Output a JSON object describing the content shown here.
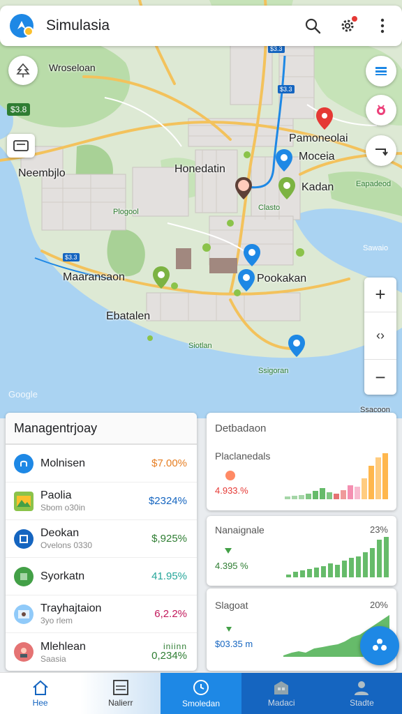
{
  "app": {
    "title": "Simulasia"
  },
  "map": {
    "labels": {
      "wroseloan": "Wroseloan",
      "nembjlo": "Neembjlo",
      "honedatin": "Honedatin",
      "pamoneolai": "Pamoneolai",
      "mocela": "Moceia",
      "kadan": "Kadan",
      "masanasaon": "Maaransaon",
      "pookakan": "Pookakan",
      "ebatalen": "Ebatalen"
    },
    "small_labels": {
      "plogool": "Plogool",
      "clasto": "Clasto",
      "siotlan": "Siotlan",
      "eapadeod": "Eapadeod",
      "ssigoran": "Ssigoran",
      "sawaio": "Sawaio",
      "ssacoon": "Ssacoon"
    },
    "badges": {
      "left_green": "$3.8",
      "top1": "$3.3",
      "top2": "$3.3",
      "blue_left": "$3.3"
    },
    "attribution": "Google"
  },
  "management": {
    "title": "Managentrjoay",
    "rows": [
      {
        "name": "Molnisen",
        "sub": "",
        "value": "$7.00%",
        "color": "#e67e22",
        "icon": "blue-circle-icon"
      },
      {
        "name": "Paolia",
        "sub": "Sbom o30in",
        "value": "$2324%",
        "color": "#1565c0",
        "icon": "landscape-icon"
      },
      {
        "name": "Deokan",
        "sub": "Ovelons 0330",
        "value": "$,925%",
        "color": "#2e7d32",
        "icon": "blue-square-icon"
      },
      {
        "name": "Syorkatn",
        "sub": "",
        "value": "41.95%",
        "color": "#26a69a",
        "icon": "map-icon"
      },
      {
        "name": "Trayhajtaion",
        "sub": "3yo rlem",
        "value": "6,2.2%",
        "color": "#c2185b",
        "icon": "photo-icon"
      },
      {
        "name": "Mlehlean",
        "sub": "Saasia",
        "value": "0,234%",
        "color": "#2e7d32",
        "icon": "avatar-icon"
      }
    ],
    "extra_top_value": "iniinn"
  },
  "stats": {
    "card1": {
      "title": "Detbadaon",
      "subtitle": "Placlanedals",
      "value": "4.933.%",
      "value_color": "#e53935"
    },
    "card2": {
      "title": "Nanaignale",
      "pct": "23%",
      "value": "4.395 %",
      "value_color": "#2e7d32"
    },
    "card3": {
      "title": "Slagoat",
      "pct": "20%",
      "value": "$03.35 m",
      "value_color": "#1565c0"
    }
  },
  "nav": {
    "items": [
      {
        "label": "Hee",
        "icon": "home-icon"
      },
      {
        "label": "Nalierr",
        "icon": "list-icon"
      },
      {
        "label": "Smoledan",
        "icon": "clock-icon"
      },
      {
        "label": "Madaci",
        "icon": "building-icon"
      },
      {
        "label": "Stadte",
        "icon": "person-icon"
      }
    ]
  },
  "colors": {
    "accent": "#1e88e5",
    "water": "#aad3f2",
    "park": "#b9dca9",
    "road": "#f3c25c"
  }
}
